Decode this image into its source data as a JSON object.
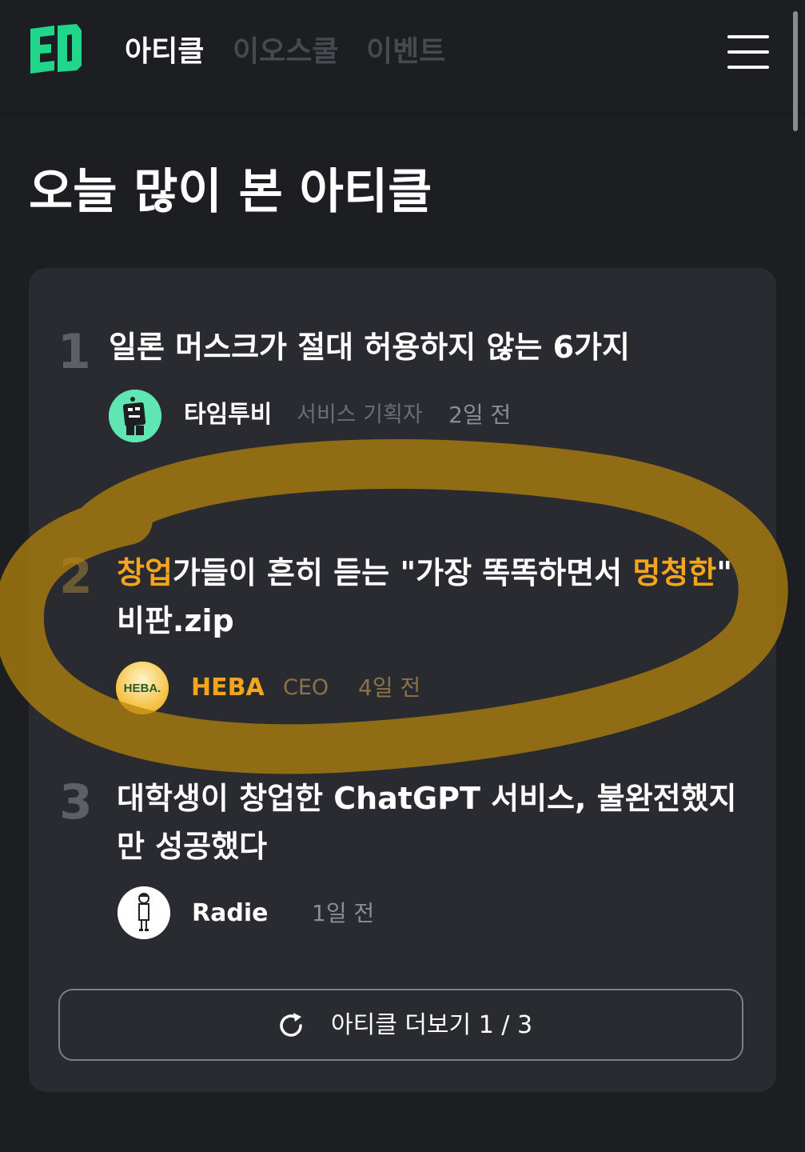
{
  "header": {
    "tabs": [
      {
        "label": "아티클",
        "active": true
      },
      {
        "label": "이오스쿨",
        "active": false
      },
      {
        "label": "이벤트",
        "active": false
      }
    ],
    "menu_icon": "hamburger-menu-icon",
    "logo_icon": "eo-logo-icon"
  },
  "section": {
    "title": "오늘 많이 본 아티클"
  },
  "articles": [
    {
      "rank": "1",
      "title": "일론 머스크가 절대 허용하지 않는 6가지",
      "author": "타임투비",
      "role": "서비스 기획자",
      "time": "2일 전"
    },
    {
      "rank": "2",
      "title_parts": [
        "창업",
        "가들이 흔히 듣는 \"가장 똑똑하면서 ",
        "멍청한",
        "\"",
        "비판.zip"
      ],
      "author": "HEBA",
      "avatar_text": "HEBA.",
      "role": "CEO",
      "time": "4일 전"
    },
    {
      "rank": "3",
      "title_parts": [
        "대학생이 ",
        "창업한",
        " ChatGPT 서비스, 불완전했지",
        "만 성공했다"
      ],
      "author": "Radie",
      "time": "1일 전"
    }
  ],
  "more_button": {
    "label": "아티클 더보기",
    "page": "1 / 3",
    "icon": "refresh-icon"
  },
  "colors": {
    "background": "#1d1e22",
    "card": "#2a2b30",
    "highlight": "#f4a51c",
    "logo": "#1fd68a"
  }
}
